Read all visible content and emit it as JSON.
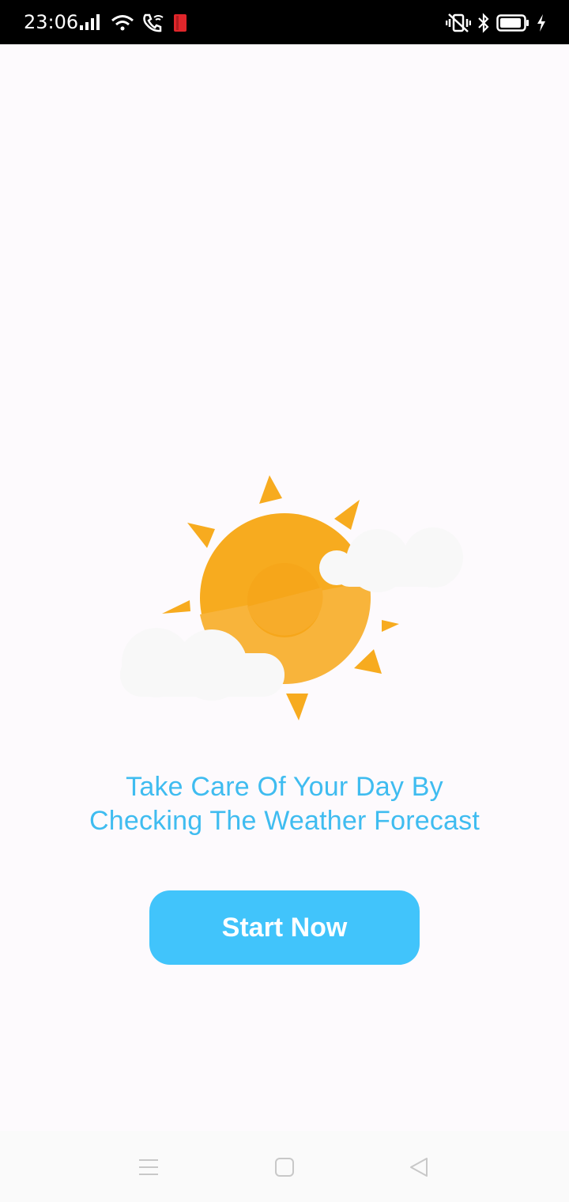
{
  "status_bar": {
    "time": "23:06",
    "left_icons": [
      "signal-bars-icon",
      "wifi-icon",
      "wifi-call-icon",
      "notification-app-icon"
    ],
    "right_icons": [
      "vibrate-icon",
      "bluetooth-icon",
      "battery-icon",
      "charging-icon"
    ]
  },
  "illustration": {
    "name": "sun-with-clouds",
    "colors": {
      "sun": "#f7ab1f",
      "sun_light": "#f8b43b",
      "cloud": "#f8f8f8"
    }
  },
  "tagline": {
    "line1": "Take Care Of Your Day By",
    "line2": "Checking The Weather Forecast"
  },
  "cta": {
    "label": "Start Now"
  },
  "nav_bar": {
    "items": [
      "menu-icon",
      "home-square-icon",
      "back-triangle-icon"
    ]
  },
  "colors": {
    "accent": "#41c4fb",
    "tagline_text": "#3fbcf0",
    "background": "#fdfafd"
  }
}
